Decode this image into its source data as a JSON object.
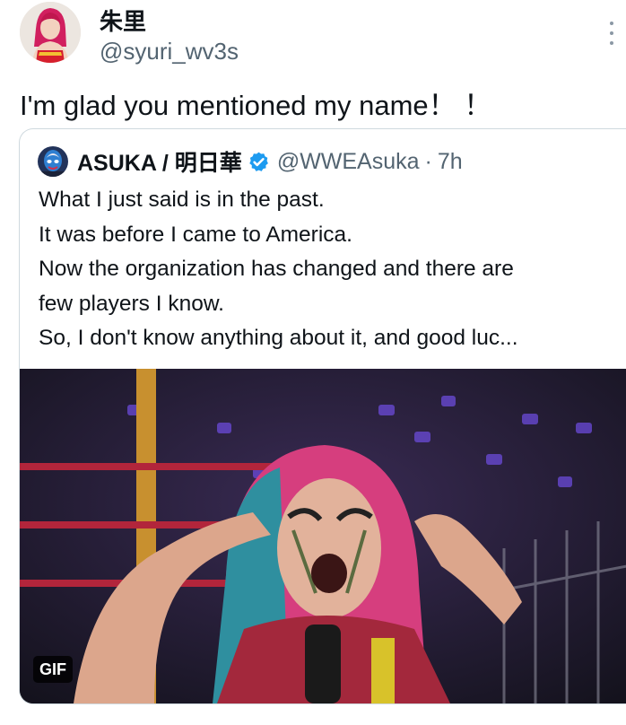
{
  "tweet": {
    "display_name": "朱里",
    "handle": "@syuri_wv3s",
    "text": "I'm glad you mentioned my name！ ！"
  },
  "quote": {
    "display_name": "ASUKA / 明日華",
    "handle": "@WWEAsuka",
    "separator": "·",
    "time": "7h",
    "lines": [
      "What I just said is in the past.",
      "It was before I came to America.",
      "Now the organization has changed and there are",
      "few players I know.",
      "So, I don't know anything about it, and good luc..."
    ],
    "media": {
      "badge": "GIF"
    }
  },
  "colors": {
    "text": "#0f1419",
    "secondary": "#536471",
    "verified": "#1d9bf0",
    "border": "#cfd9de"
  }
}
